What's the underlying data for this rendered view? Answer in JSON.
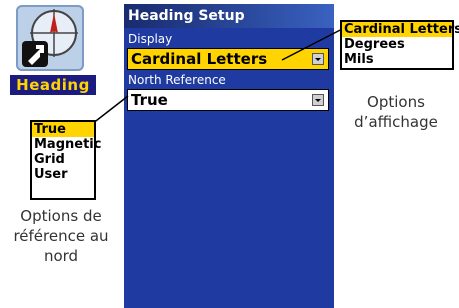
{
  "app_icon": {
    "label": "Heading",
    "icon": "compass-arrow-icon"
  },
  "screen": {
    "title": "Heading Setup",
    "display": {
      "label": "Display",
      "value": "Cardinal Letters"
    },
    "north_reference": {
      "label": "North Reference",
      "value": "True"
    }
  },
  "display_options": {
    "items": [
      "Cardinal Letters",
      "Degrees",
      "Mils"
    ],
    "selected": "Cardinal Letters",
    "caption_line1": "Options",
    "caption_line2": "d’affichage"
  },
  "north_options": {
    "items": [
      "True",
      "Magnetic",
      "Grid",
      "User"
    ],
    "selected": "True",
    "caption_line1": "Options de",
    "caption_line2": "référence au",
    "caption_line3": "nord"
  },
  "colors": {
    "screen_blue": "#1f3aa0",
    "highlight_yellow": "#ffd400",
    "caption_navy": "#1c1c80"
  }
}
